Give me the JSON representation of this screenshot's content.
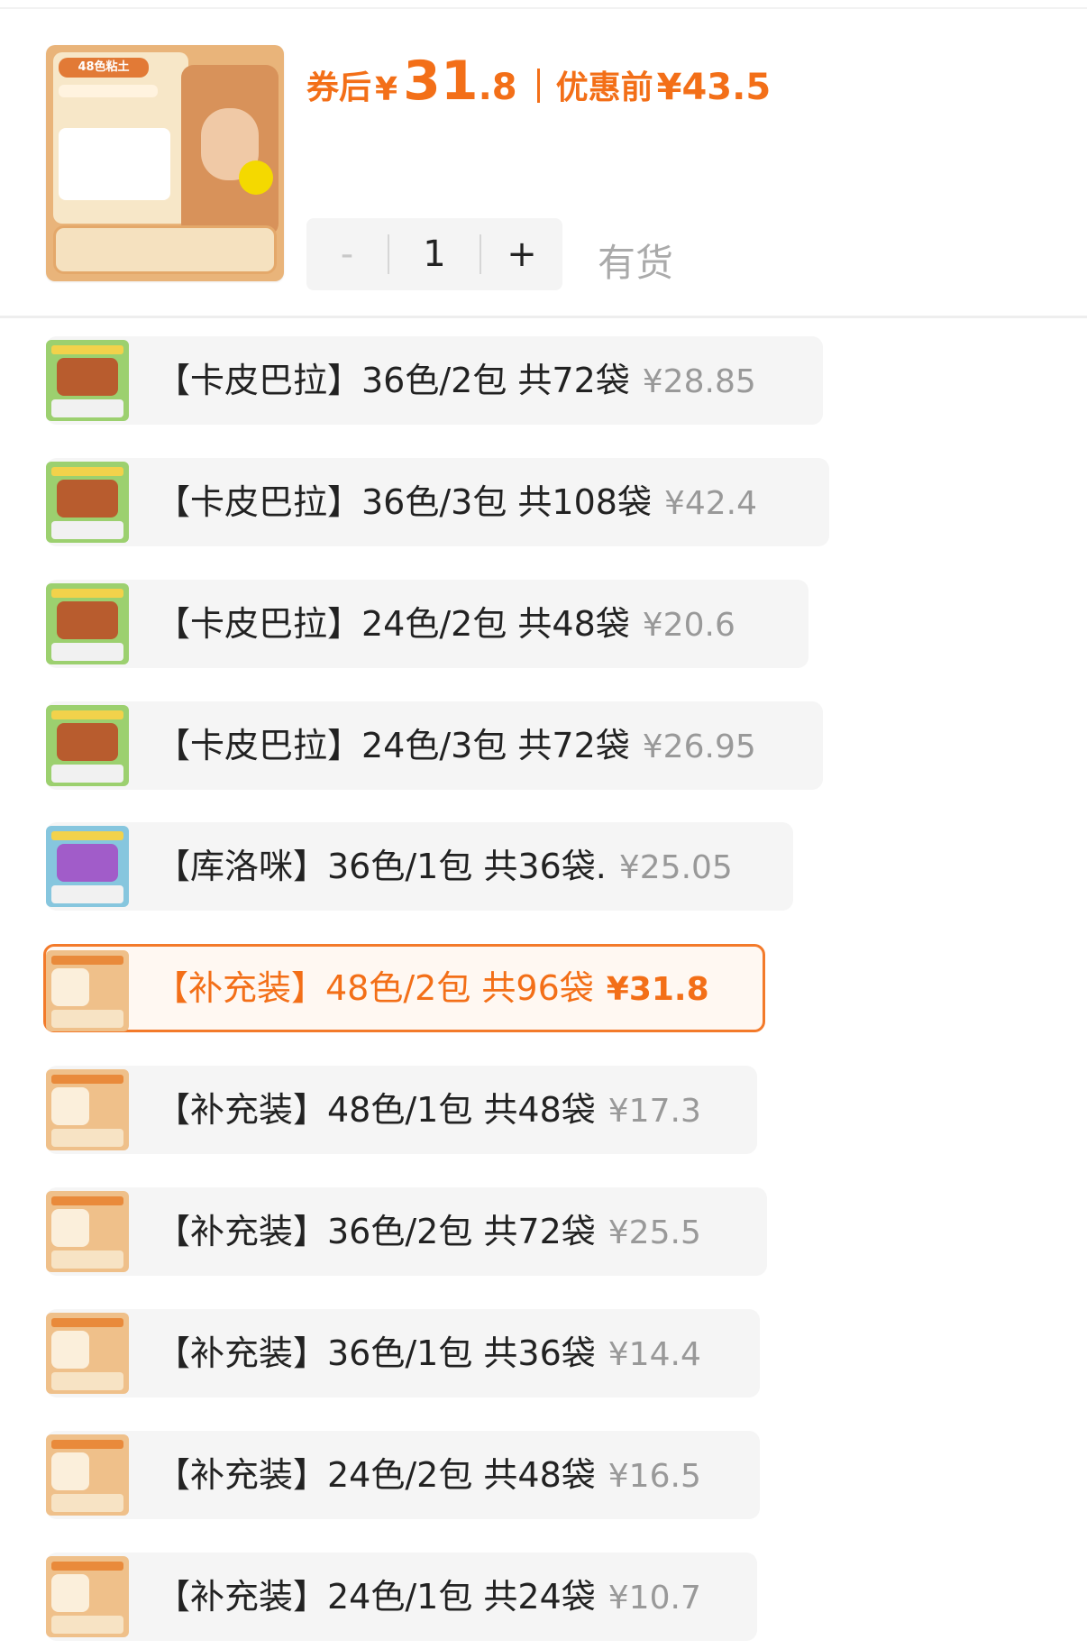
{
  "product": {
    "hero_image_title": "48色粘土",
    "coupon_label": "券后",
    "currency": "¥",
    "coupon_price_int": "31",
    "coupon_price_dec": ".8",
    "original_label": "优惠前",
    "original_price": "¥43.5",
    "accent_color": "#f36f18"
  },
  "quantity": {
    "minus": "-",
    "value": "1",
    "plus": "+",
    "stock": "有货"
  },
  "options": [
    {
      "label": "【卡皮巴拉】36色/2包 共72袋",
      "price": "¥28.85",
      "selected": false,
      "thumb": "capybara-box-thumbnail"
    },
    {
      "label": "【卡皮巴拉】36色/3包 共108袋",
      "price": "¥42.4",
      "selected": false,
      "thumb": "capybara-box-thumbnail"
    },
    {
      "label": "【卡皮巴拉】24色/2包 共48袋",
      "price": "¥20.6",
      "selected": false,
      "thumb": "capybara-box-thumbnail"
    },
    {
      "label": "【卡皮巴拉】24色/3包 共72袋",
      "price": "¥26.95",
      "selected": false,
      "thumb": "capybara-box-thumbnail"
    },
    {
      "label": "【库洛咪】36色/1包 共36袋.",
      "price": "¥25.05",
      "selected": false,
      "thumb": "kuromi-box-thumbnail"
    },
    {
      "label": "【补充装】48色/2包 共96袋",
      "price": "¥31.8",
      "selected": true,
      "thumb": "refill-bag-thumbnail"
    },
    {
      "label": "【补充装】48色/1包 共48袋",
      "price": "¥17.3",
      "selected": false,
      "thumb": "refill-bag-thumbnail"
    },
    {
      "label": "【补充装】36色/2包 共72袋",
      "price": "¥25.5",
      "selected": false,
      "thumb": "refill-bag-thumbnail"
    },
    {
      "label": "【补充装】36色/1包 共36袋",
      "price": "¥14.4",
      "selected": false,
      "thumb": "refill-bag-thumbnail"
    },
    {
      "label": "【补充装】24色/2包 共48袋",
      "price": "¥16.5",
      "selected": false,
      "thumb": "refill-bag-thumbnail"
    },
    {
      "label": "【补充装】24色/1包 共24袋",
      "price": "¥10.7",
      "selected": false,
      "thumb": "refill-bag-thumbnail"
    }
  ]
}
